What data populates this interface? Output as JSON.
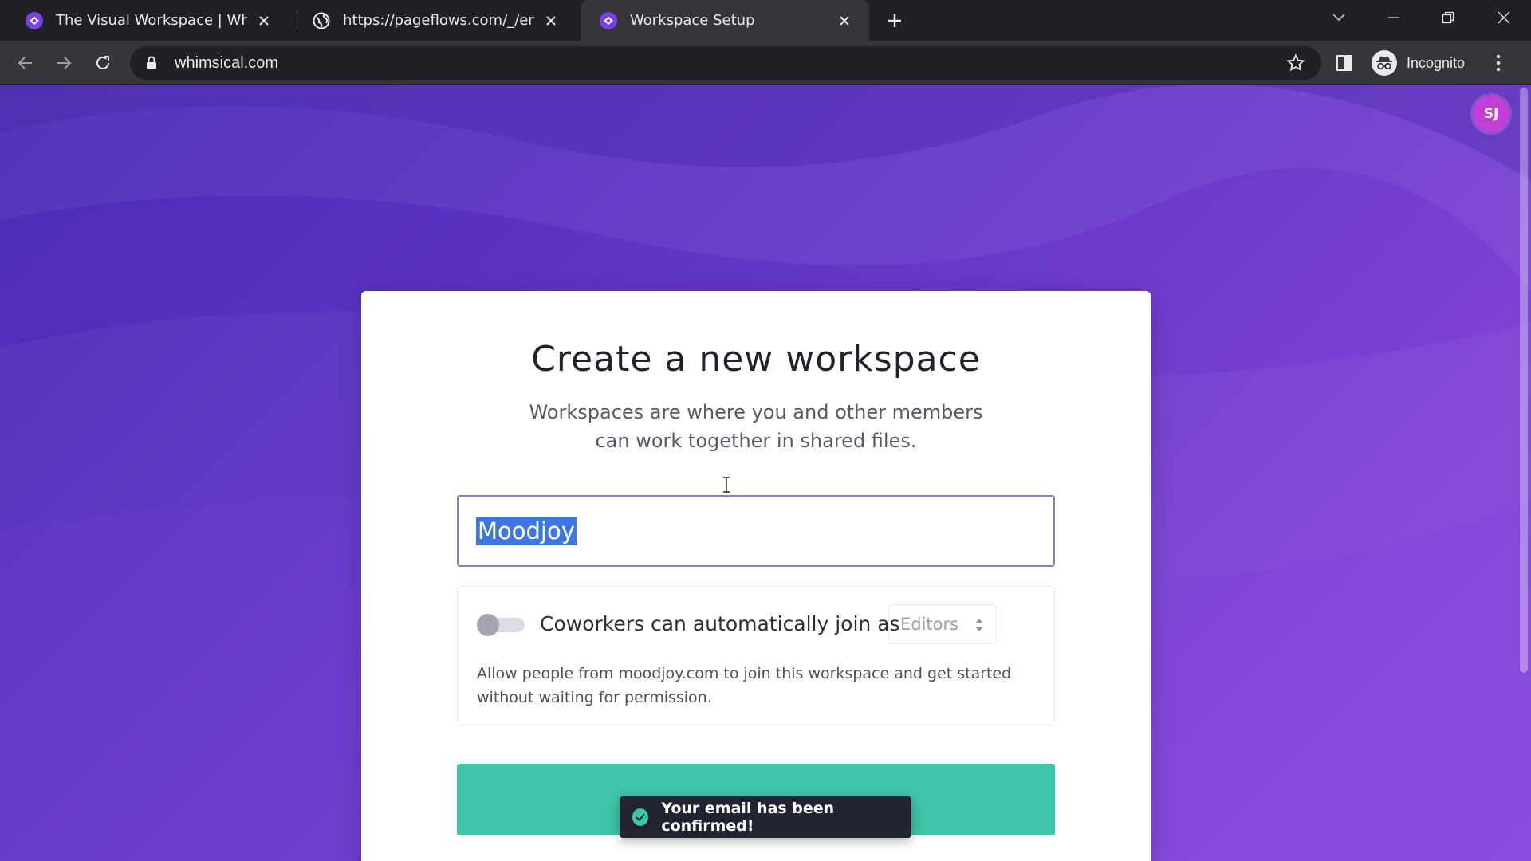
{
  "browser": {
    "tabs": [
      {
        "title": "The Visual Workspace | Whimsical",
        "favicon": "whimsical-icon",
        "active": false
      },
      {
        "title": "https://pageflows.com/_/emails/",
        "favicon": "globe-icon",
        "active": false
      },
      {
        "title": "Workspace Setup",
        "favicon": "whimsical-icon",
        "active": true
      }
    ],
    "url": "whimsical.com",
    "profile_label": "Incognito"
  },
  "user": {
    "initials": "SJ"
  },
  "card": {
    "title": "Create a new workspace",
    "subtitle_line1": "Workspaces are where you and other members",
    "subtitle_line2": "can work together in shared files.",
    "workspace_name": "Moodjoy",
    "auto_join": {
      "enabled": false,
      "label": "Coworkers can automatically join as",
      "role": "Editors",
      "help_line1": "Allow people from moodjoy.com to join this workspace and get started",
      "help_line2": "without waiting for permission."
    }
  },
  "toast": {
    "message": "Your email has been confirmed!"
  },
  "colors": {
    "accent_purple": "#6f3ccd",
    "button_green": "#3ec4a7",
    "avatar": "#c13fd6",
    "selection_blue": "#3f77e0"
  }
}
